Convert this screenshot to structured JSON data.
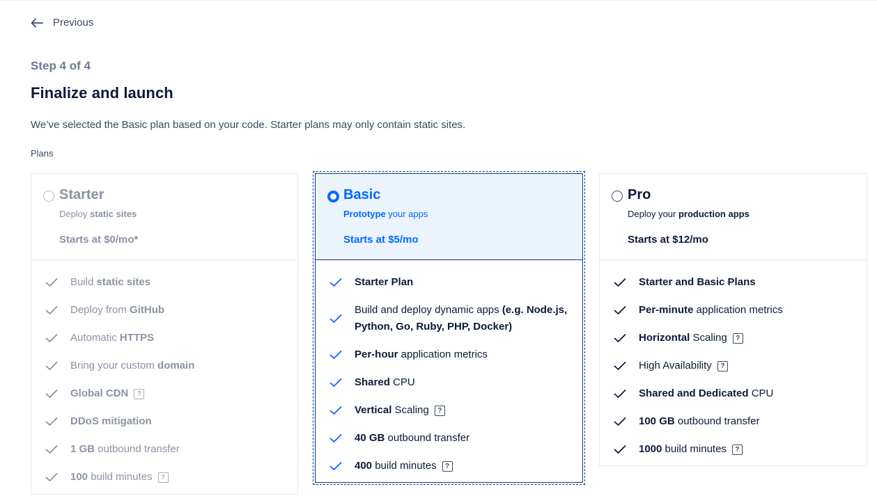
{
  "nav": {
    "previous_label": "Previous"
  },
  "header": {
    "step": "Step 4 of 4",
    "title": "Finalize and launch",
    "description": "We’ve selected the Basic plan based on your code. Starter plans may only contain static sites.",
    "plans_label": "Plans"
  },
  "plans": {
    "starter": {
      "name": "Starter",
      "tag_prefix": "Deploy ",
      "tag_bold": "static sites",
      "tag_suffix": "",
      "price": "Starts at $0/mo*",
      "features": [
        {
          "pre": "Build ",
          "bold": "static sites",
          "post": ""
        },
        {
          "pre": "Deploy from ",
          "bold": "GitHub",
          "post": ""
        },
        {
          "pre": "Automatic ",
          "bold": "HTTPS",
          "post": ""
        },
        {
          "pre": "Bring your custom ",
          "bold": "domain",
          "post": ""
        },
        {
          "pre": "",
          "bold": "Global CDN",
          "post": "",
          "help": "?"
        },
        {
          "pre": "",
          "bold": "DDoS mitigation",
          "post": ""
        },
        {
          "pre": "",
          "bold": "1 GB",
          "post": " outbound transfer"
        },
        {
          "pre": "",
          "bold": "100",
          "post": " build minutes",
          "help": "?"
        }
      ]
    },
    "basic": {
      "name": "Basic",
      "tag_prefix": "",
      "tag_bold": "Prototype",
      "tag_suffix": " your apps",
      "price": "Starts at $5/mo",
      "features": [
        {
          "pre": "",
          "bold": "Starter Plan",
          "post": ""
        },
        {
          "pre": "Build and deploy dynamic apps ",
          "bold": "(e.g. Node.js, Python, Go, Ruby, PHP, Docker)",
          "post": ""
        },
        {
          "pre": "",
          "bold": "Per-hour",
          "post": " application metrics"
        },
        {
          "pre": "",
          "bold": "Shared",
          "post": " CPU"
        },
        {
          "pre": "",
          "bold": "Vertical",
          "post": " Scaling",
          "help": "?"
        },
        {
          "pre": "",
          "bold": "40 GB",
          "post": " outbound transfer"
        },
        {
          "pre": "",
          "bold": "400",
          "post": " build minutes",
          "help": "?"
        }
      ]
    },
    "pro": {
      "name": "Pro",
      "tag_prefix": "Deploy your ",
      "tag_bold": "production apps",
      "tag_suffix": "",
      "price": "Starts at $12/mo",
      "features": [
        {
          "pre": "",
          "bold": "Starter and Basic Plans",
          "post": ""
        },
        {
          "pre": "",
          "bold": "Per-minute",
          "post": " application metrics"
        },
        {
          "pre": "",
          "bold": "Horizontal",
          "post": " Scaling",
          "help": "?"
        },
        {
          "pre": "High Availability",
          "bold": "",
          "post": "",
          "help": "?"
        },
        {
          "pre": "",
          "bold": "Shared and Dedicated",
          "post": " CPU"
        },
        {
          "pre": "",
          "bold": "100 GB",
          "post": " outbound transfer"
        },
        {
          "pre": "",
          "bold": "1000",
          "post": " build minutes",
          "help": "?"
        }
      ]
    }
  },
  "selected_plan": "Basic",
  "colors": {
    "accent": "#0069ff",
    "selected_bg": "#ebf4fd",
    "muted": "#8a93a3",
    "text": "#0b1a3a"
  },
  "icons": {
    "back": "arrow-left-icon",
    "check": "checkmark-icon",
    "help": "question-mark-icon"
  }
}
